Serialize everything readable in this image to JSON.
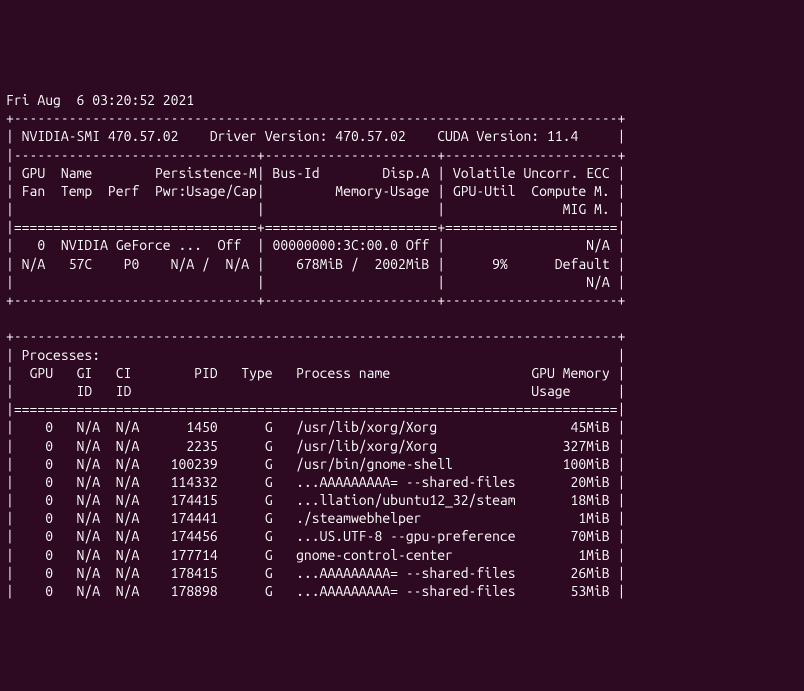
{
  "timestamp": "Fri Aug  6 03:20:52 2021",
  "header": {
    "divider_top": "+-----------------------------------------------------------------------------+",
    "smi_line": "| NVIDIA-SMI 470.57.02    Driver Version: 470.57.02    CUDA Version: 11.4     |",
    "divider_mid": "|-------------------------------+----------------------+----------------------+",
    "col_line1": "| GPU  Name        Persistence-M| Bus-Id        Disp.A | Volatile Uncorr. ECC |",
    "col_line2": "| Fan  Temp  Perf  Pwr:Usage/Cap|         Memory-Usage | GPU-Util  Compute M. |",
    "col_line3": "|                               |                      |               MIG M. |",
    "divider_eq": "|===============================+======================+======================|"
  },
  "gpu": {
    "line1": "|   0  NVIDIA GeForce ...  Off  | 00000000:3C:00.0 Off |                  N/A |",
    "line2": "| N/A   57C    P0    N/A /  N/A |    678MiB /  2002MiB |      9%      Default |",
    "line3": "|                               |                      |                  N/A |",
    "divider_end": "+-------------------------------+----------------------+----------------------+"
  },
  "processes": {
    "divider_top": "+-----------------------------------------------------------------------------+",
    "title": "| Processes:                                                                  |",
    "header1": "|  GPU   GI   CI        PID   Type   Process name                  GPU Memory |",
    "header2": "|        ID   ID                                                   Usage      |",
    "divider_eq": "|=============================================================================|",
    "rows": [
      "|    0   N/A  N/A      1450      G   /usr/lib/xorg/Xorg                 45MiB |",
      "|    0   N/A  N/A      2235      G   /usr/lib/xorg/Xorg                327MiB |",
      "|    0   N/A  N/A    100239      G   /usr/bin/gnome-shell              100MiB |",
      "|    0   N/A  N/A    114332      G   ...AAAAAAAAA= --shared-files       20MiB |",
      "|    0   N/A  N/A    174415      G   ...llation/ubuntu12_32/steam       18MiB |",
      "|    0   N/A  N/A    174441      G   ./steamwebhelper                    1MiB |",
      "|    0   N/A  N/A    174456      G   ...US.UTF-8 --gpu-preference       70MiB |",
      "|    0   N/A  N/A    177714      G   gnome-control-center                1MiB |",
      "|    0   N/A  N/A    178415      G   ...AAAAAAAAA= --shared-files       26MiB |",
      "|    0   N/A  N/A    178898      G   ...AAAAAAAAA= --shared-files       53MiB |"
    ]
  },
  "chart_data": {
    "type": "table",
    "title": "nvidia-smi output",
    "driver_version": "470.57.02",
    "cuda_version": "11.4",
    "gpus": [
      {
        "id": 0,
        "name": "NVIDIA GeForce ...",
        "persistence_m": "Off",
        "bus_id": "00000000:3C:00.0",
        "disp_a": "Off",
        "ecc": "N/A",
        "fan": "N/A",
        "temp_c": 57,
        "perf": "P0",
        "pwr_usage": "N/A",
        "pwr_cap": "N/A",
        "mem_used_mib": 678,
        "mem_total_mib": 2002,
        "gpu_util_pct": 9,
        "compute_m": "Default",
        "mig_m": "N/A"
      }
    ],
    "processes": [
      {
        "gpu": 0,
        "gi_id": "N/A",
        "ci_id": "N/A",
        "pid": 1450,
        "type": "G",
        "name": "/usr/lib/xorg/Xorg",
        "mem_mib": 45
      },
      {
        "gpu": 0,
        "gi_id": "N/A",
        "ci_id": "N/A",
        "pid": 2235,
        "type": "G",
        "name": "/usr/lib/xorg/Xorg",
        "mem_mib": 327
      },
      {
        "gpu": 0,
        "gi_id": "N/A",
        "ci_id": "N/A",
        "pid": 100239,
        "type": "G",
        "name": "/usr/bin/gnome-shell",
        "mem_mib": 100
      },
      {
        "gpu": 0,
        "gi_id": "N/A",
        "ci_id": "N/A",
        "pid": 114332,
        "type": "G",
        "name": "...AAAAAAAAA= --shared-files",
        "mem_mib": 20
      },
      {
        "gpu": 0,
        "gi_id": "N/A",
        "ci_id": "N/A",
        "pid": 174415,
        "type": "G",
        "name": "...llation/ubuntu12_32/steam",
        "mem_mib": 18
      },
      {
        "gpu": 0,
        "gi_id": "N/A",
        "ci_id": "N/A",
        "pid": 174441,
        "type": "G",
        "name": "./steamwebhelper",
        "mem_mib": 1
      },
      {
        "gpu": 0,
        "gi_id": "N/A",
        "ci_id": "N/A",
        "pid": 174456,
        "type": "G",
        "name": "...US.UTF-8 --gpu-preference",
        "mem_mib": 70
      },
      {
        "gpu": 0,
        "gi_id": "N/A",
        "ci_id": "N/A",
        "pid": 177714,
        "type": "G",
        "name": "gnome-control-center",
        "mem_mib": 1
      },
      {
        "gpu": 0,
        "gi_id": "N/A",
        "ci_id": "N/A",
        "pid": 178415,
        "type": "G",
        "name": "...AAAAAAAAA= --shared-files",
        "mem_mib": 26
      },
      {
        "gpu": 0,
        "gi_id": "N/A",
        "ci_id": "N/A",
        "pid": 178898,
        "type": "G",
        "name": "...AAAAAAAAA= --shared-files",
        "mem_mib": 53
      }
    ]
  }
}
